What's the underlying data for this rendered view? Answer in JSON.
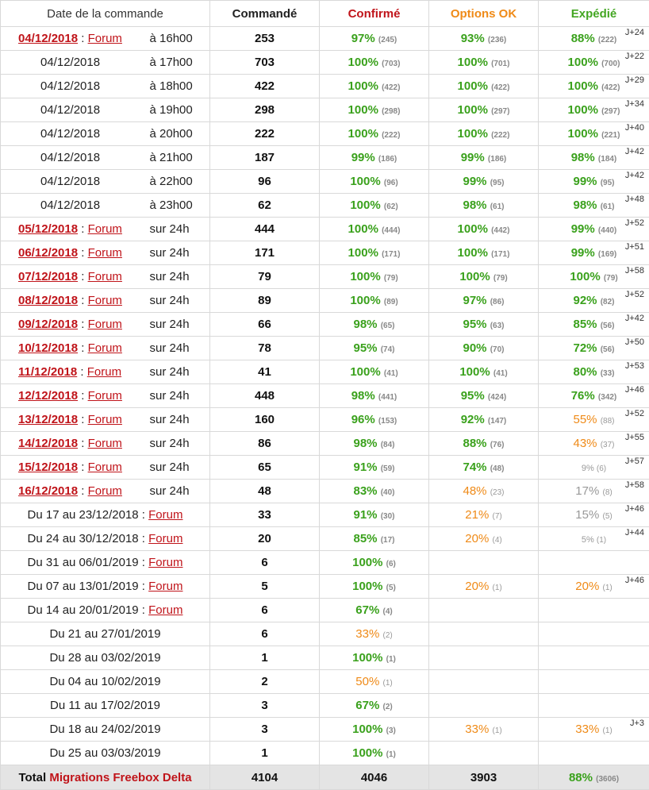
{
  "header": {
    "date": "Date de la commande",
    "commande": "Commandé",
    "confirme": "Confirmé",
    "options": "Options OK",
    "expedie": "Expédié"
  },
  "day_rows": [
    {
      "date": "04/12/2018",
      "forum": "Forum",
      "time": "à 16h00",
      "count": "253",
      "c": {
        "p": "97%",
        "n": "(245)",
        "s": "green"
      },
      "o": {
        "p": "93%",
        "n": "(236)",
        "s": "green"
      },
      "e": {
        "p": "88%",
        "n": "(222)",
        "s": "green"
      },
      "j": "J+24",
      "bold": true
    },
    {
      "date": "04/12/2018",
      "forum": "",
      "time": "à 17h00",
      "count": "703",
      "c": {
        "p": "100%",
        "n": "(703)",
        "s": "green"
      },
      "o": {
        "p": "100%",
        "n": "(701)",
        "s": "green"
      },
      "e": {
        "p": "100%",
        "n": "(700)",
        "s": "green"
      },
      "j": "J+22",
      "bold": false
    },
    {
      "date": "04/12/2018",
      "forum": "",
      "time": "à 18h00",
      "count": "422",
      "c": {
        "p": "100%",
        "n": "(422)",
        "s": "green"
      },
      "o": {
        "p": "100%",
        "n": "(422)",
        "s": "green"
      },
      "e": {
        "p": "100%",
        "n": "(422)",
        "s": "green"
      },
      "j": "J+29",
      "bold": false
    },
    {
      "date": "04/12/2018",
      "forum": "",
      "time": "à 19h00",
      "count": "298",
      "c": {
        "p": "100%",
        "n": "(298)",
        "s": "green"
      },
      "o": {
        "p": "100%",
        "n": "(297)",
        "s": "green"
      },
      "e": {
        "p": "100%",
        "n": "(297)",
        "s": "green"
      },
      "j": "J+34",
      "bold": false
    },
    {
      "date": "04/12/2018",
      "forum": "",
      "time": "à 20h00",
      "count": "222",
      "c": {
        "p": "100%",
        "n": "(222)",
        "s": "green"
      },
      "o": {
        "p": "100%",
        "n": "(222)",
        "s": "green"
      },
      "e": {
        "p": "100%",
        "n": "(221)",
        "s": "green"
      },
      "j": "J+40",
      "bold": false
    },
    {
      "date": "04/12/2018",
      "forum": "",
      "time": "à 21h00",
      "count": "187",
      "c": {
        "p": "99%",
        "n": "(186)",
        "s": "green"
      },
      "o": {
        "p": "99%",
        "n": "(186)",
        "s": "green"
      },
      "e": {
        "p": "98%",
        "n": "(184)",
        "s": "green"
      },
      "j": "J+42",
      "bold": false
    },
    {
      "date": "04/12/2018",
      "forum": "",
      "time": "à 22h00",
      "count": "96",
      "c": {
        "p": "100%",
        "n": "(96)",
        "s": "green"
      },
      "o": {
        "p": "99%",
        "n": "(95)",
        "s": "green"
      },
      "e": {
        "p": "99%",
        "n": "(95)",
        "s": "green"
      },
      "j": "J+42",
      "bold": false
    },
    {
      "date": "04/12/2018",
      "forum": "",
      "time": "à 23h00",
      "count": "62",
      "c": {
        "p": "100%",
        "n": "(62)",
        "s": "green"
      },
      "o": {
        "p": "98%",
        "n": "(61)",
        "s": "green"
      },
      "e": {
        "p": "98%",
        "n": "(61)",
        "s": "green"
      },
      "j": "J+48",
      "bold": false
    },
    {
      "date": "05/12/2018",
      "forum": "Forum",
      "time": "sur 24h",
      "count": "444",
      "c": {
        "p": "100%",
        "n": "(444)",
        "s": "green"
      },
      "o": {
        "p": "100%",
        "n": "(442)",
        "s": "green"
      },
      "e": {
        "p": "99%",
        "n": "(440)",
        "s": "green"
      },
      "j": "J+52",
      "bold": true
    },
    {
      "date": "06/12/2018",
      "forum": "Forum",
      "time": "sur 24h",
      "count": "171",
      "c": {
        "p": "100%",
        "n": "(171)",
        "s": "green"
      },
      "o": {
        "p": "100%",
        "n": "(171)",
        "s": "green"
      },
      "e": {
        "p": "99%",
        "n": "(169)",
        "s": "green"
      },
      "j": "J+51",
      "bold": true
    },
    {
      "date": "07/12/2018",
      "forum": "Forum",
      "time": "sur 24h",
      "count": "79",
      "c": {
        "p": "100%",
        "n": "(79)",
        "s": "green"
      },
      "o": {
        "p": "100%",
        "n": "(79)",
        "s": "green"
      },
      "e": {
        "p": "100%",
        "n": "(79)",
        "s": "green"
      },
      "j": "J+58",
      "bold": true
    },
    {
      "date": "08/12/2018",
      "forum": "Forum",
      "time": "sur 24h",
      "count": "89",
      "c": {
        "p": "100%",
        "n": "(89)",
        "s": "green"
      },
      "o": {
        "p": "97%",
        "n": "(86)",
        "s": "green"
      },
      "e": {
        "p": "92%",
        "n": "(82)",
        "s": "green"
      },
      "j": "J+52",
      "bold": true
    },
    {
      "date": "09/12/2018",
      "forum": "Forum",
      "time": "sur 24h",
      "count": "66",
      "c": {
        "p": "98%",
        "n": "(65)",
        "s": "green"
      },
      "o": {
        "p": "95%",
        "n": "(63)",
        "s": "green"
      },
      "e": {
        "p": "85%",
        "n": "(56)",
        "s": "green"
      },
      "j": "J+42",
      "bold": true
    },
    {
      "date": "10/12/2018",
      "forum": "Forum",
      "time": "sur 24h",
      "count": "78",
      "c": {
        "p": "95%",
        "n": "(74)",
        "s": "green"
      },
      "o": {
        "p": "90%",
        "n": "(70)",
        "s": "green"
      },
      "e": {
        "p": "72%",
        "n": "(56)",
        "s": "green"
      },
      "j": "J+50",
      "bold": true
    },
    {
      "date": "11/12/2018",
      "forum": "Forum",
      "time": "sur 24h",
      "count": "41",
      "c": {
        "p": "100%",
        "n": "(41)",
        "s": "green"
      },
      "o": {
        "p": "100%",
        "n": "(41)",
        "s": "green"
      },
      "e": {
        "p": "80%",
        "n": "(33)",
        "s": "green"
      },
      "j": "J+53",
      "bold": true
    },
    {
      "date": "12/12/2018",
      "forum": "Forum",
      "time": "sur 24h",
      "count": "448",
      "c": {
        "p": "98%",
        "n": "(441)",
        "s": "green"
      },
      "o": {
        "p": "95%",
        "n": "(424)",
        "s": "green"
      },
      "e": {
        "p": "76%",
        "n": "(342)",
        "s": "green"
      },
      "j": "J+46",
      "bold": true
    },
    {
      "date": "13/12/2018",
      "forum": "Forum",
      "time": "sur 24h",
      "count": "160",
      "c": {
        "p": "96%",
        "n": "(153)",
        "s": "green"
      },
      "o": {
        "p": "92%",
        "n": "(147)",
        "s": "green"
      },
      "e": {
        "p": "55%",
        "n": "(88)",
        "s": "orange"
      },
      "j": "J+52",
      "bold": true
    },
    {
      "date": "14/12/2018",
      "forum": "Forum",
      "time": "sur 24h",
      "count": "86",
      "c": {
        "p": "98%",
        "n": "(84)",
        "s": "green"
      },
      "o": {
        "p": "88%",
        "n": "(76)",
        "s": "green"
      },
      "e": {
        "p": "43%",
        "n": "(37)",
        "s": "orange"
      },
      "j": "J+55",
      "bold": true
    },
    {
      "date": "15/12/2018",
      "forum": "Forum",
      "time": "sur 24h",
      "count": "65",
      "c": {
        "p": "91%",
        "n": "(59)",
        "s": "green"
      },
      "o": {
        "p": "74%",
        "n": "(48)",
        "s": "green"
      },
      "e": {
        "p": "9%",
        "n": "(6)",
        "s": "gray-small"
      },
      "j": "J+57",
      "bold": true
    },
    {
      "date": "16/12/2018",
      "forum": "Forum",
      "time": "sur 24h",
      "count": "48",
      "c": {
        "p": "83%",
        "n": "(40)",
        "s": "green"
      },
      "o": {
        "p": "48%",
        "n": "(23)",
        "s": "orange"
      },
      "e": {
        "p": "17%",
        "n": "(8)",
        "s": "gray"
      },
      "j": "J+58",
      "bold": true
    }
  ],
  "week_rows": [
    {
      "label": "Du 17 au 23/12/2018 : ",
      "forum": "Forum",
      "count": "33",
      "c": {
        "p": "91%",
        "n": "(30)",
        "s": "green"
      },
      "o": {
        "p": "21%",
        "n": "(7)",
        "s": "orange"
      },
      "e": {
        "p": "15%",
        "n": "(5)",
        "s": "gray"
      },
      "j": "J+46"
    },
    {
      "label": "Du 24 au 30/12/2018 : ",
      "forum": "Forum",
      "count": "20",
      "c": {
        "p": "85%",
        "n": "(17)",
        "s": "green"
      },
      "o": {
        "p": "20%",
        "n": "(4)",
        "s": "orange"
      },
      "e": {
        "p": "5%",
        "n": "(1)",
        "s": "gray-small"
      },
      "j": "J+44"
    },
    {
      "label": "Du 31 au 06/01/2019 : ",
      "forum": "Forum",
      "count": "6",
      "c": {
        "p": "100%",
        "n": "(6)",
        "s": "green"
      },
      "o": null,
      "e": null,
      "j": ""
    },
    {
      "label": "Du 07 au 13/01/2019 : ",
      "forum": "Forum",
      "count": "5",
      "c": {
        "p": "100%",
        "n": "(5)",
        "s": "green"
      },
      "o": {
        "p": "20%",
        "n": "(1)",
        "s": "orange"
      },
      "e": {
        "p": "20%",
        "n": "(1)",
        "s": "orange"
      },
      "j": "J+46"
    },
    {
      "label": "Du 14 au 20/01/2019 : ",
      "forum": "Forum",
      "count": "6",
      "c": {
        "p": "67%",
        "n": "(4)",
        "s": "green"
      },
      "o": null,
      "e": null,
      "j": ""
    },
    {
      "label": "Du 21 au 27/01/2019",
      "forum": "",
      "count": "6",
      "c": {
        "p": "33%",
        "n": "(2)",
        "s": "orange"
      },
      "o": null,
      "e": null,
      "j": ""
    },
    {
      "label": "Du 28 au 03/02/2019",
      "forum": "",
      "count": "1",
      "c": {
        "p": "100%",
        "n": "(1)",
        "s": "green"
      },
      "o": null,
      "e": null,
      "j": ""
    },
    {
      "label": "Du 04 au 10/02/2019",
      "forum": "",
      "count": "2",
      "c": {
        "p": "50%",
        "n": "(1)",
        "s": "orange"
      },
      "o": null,
      "e": null,
      "j": ""
    },
    {
      "label": "Du 11 au 17/02/2019",
      "forum": "",
      "count": "3",
      "c": {
        "p": "67%",
        "n": "(2)",
        "s": "green"
      },
      "o": null,
      "e": null,
      "j": ""
    },
    {
      "label": "Du 18 au 24/02/2019",
      "forum": "",
      "count": "3",
      "c": {
        "p": "100%",
        "n": "(3)",
        "s": "green"
      },
      "o": {
        "p": "33%",
        "n": "(1)",
        "s": "orange"
      },
      "e": {
        "p": "33%",
        "n": "(1)",
        "s": "orange"
      },
      "j": "J+3"
    },
    {
      "label": "Du 25 au 03/03/2019",
      "forum": "",
      "count": "1",
      "c": {
        "p": "100%",
        "n": "(1)",
        "s": "green"
      },
      "o": null,
      "e": null,
      "j": ""
    }
  ],
  "total": {
    "label_prefix": "Total ",
    "label_highlight": "Migrations Freebox Delta",
    "commande": "4104",
    "confirme": "4046",
    "options": "3903",
    "expedie_pct": "88%",
    "expedie_n": "(3606)"
  },
  "separator": " : "
}
